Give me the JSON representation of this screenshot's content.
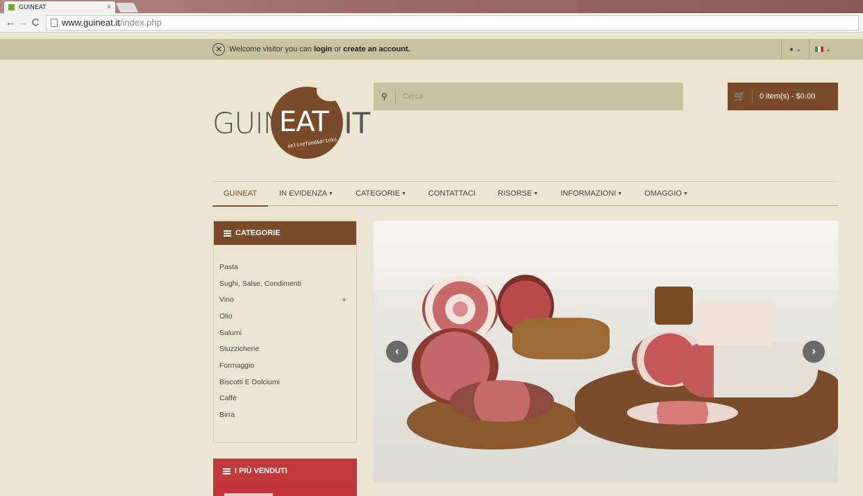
{
  "browser": {
    "tab_title": "GUINEAT",
    "tab_close": "×",
    "url_host": "www.guineat.it",
    "url_path": "/index.php"
  },
  "topbar": {
    "welcome_prefix": "Welcome visitor you can",
    "login_label": "login",
    "or_text": "or",
    "create_account_label": "create an account.",
    "user_icon": "user-icon",
    "language_flag": "italian-flag-icon"
  },
  "logo": {
    "part1": "GUIN",
    "part2": "EAT",
    "part3": ".IT",
    "tagline": "onlinefood&drinks"
  },
  "search": {
    "placeholder": "Cerca"
  },
  "cart": {
    "label": "0 item(s) - $0.00"
  },
  "nav": {
    "items": [
      {
        "label": "GUINEAT"
      },
      {
        "label": "IN EVIDENZA"
      },
      {
        "label": "CATEGORIE"
      },
      {
        "label": "CONTATTACI"
      },
      {
        "label": "RISORSE"
      },
      {
        "label": "INFORMAZIONI"
      },
      {
        "label": "OMAGGIO"
      }
    ]
  },
  "sidebar": {
    "categories_title": "CATEGORIE",
    "items": [
      {
        "label": "Pasta"
      },
      {
        "label": "Sughi, Salse, Condimenti"
      },
      {
        "label": "Vino",
        "expand": "+"
      },
      {
        "label": "Olio"
      },
      {
        "label": "Salumi"
      },
      {
        "label": "Stuzzicherie"
      },
      {
        "label": "Formaggio"
      },
      {
        "label": "Biscotti E Dolciumi"
      },
      {
        "label": "Caffè"
      },
      {
        "label": "Birra"
      }
    ],
    "bestsellers_title": "I PIÙ VENDUTI"
  },
  "colors": {
    "brand_brown": "#7b4a2a",
    "khaki": "#c8c2a2",
    "background": "#ebe6d2",
    "bestseller_red": "#c0393c"
  }
}
